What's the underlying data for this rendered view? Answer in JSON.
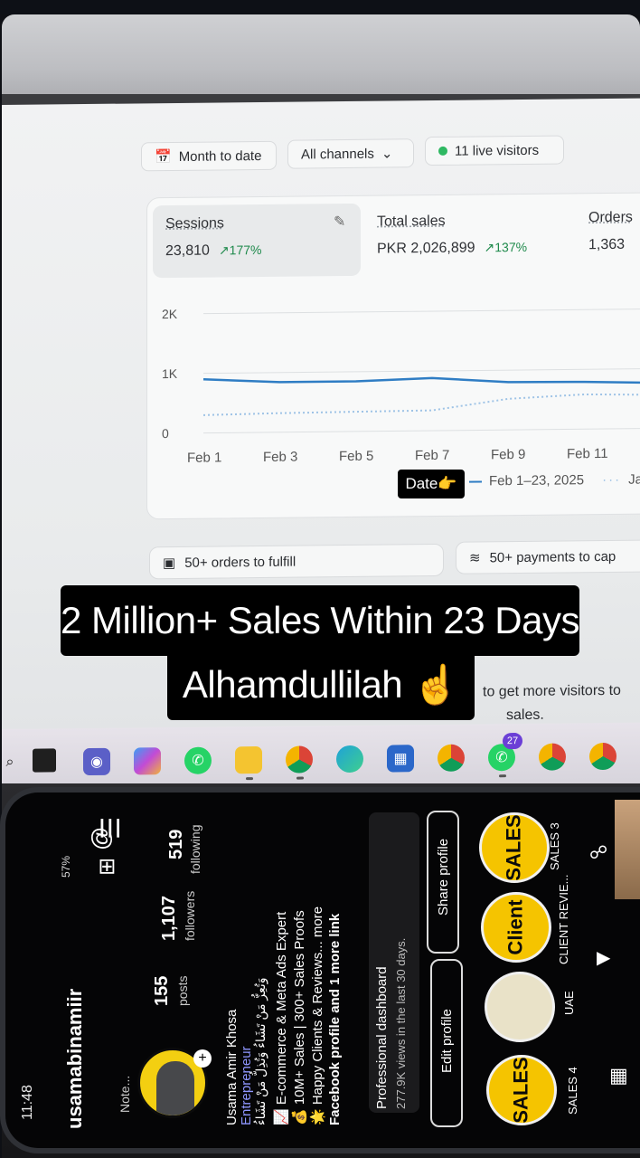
{
  "dashboard": {
    "chips": {
      "month_to_date": "Month to date",
      "all_channels": "All channels",
      "live_visitors": "11 live visitors"
    },
    "metrics": {
      "sessions_label": "Sessions",
      "sessions_value": "23,810",
      "sessions_change": "↗177%",
      "sales_label": "Total sales",
      "sales_value": "PKR 2,026,899",
      "sales_change": "↗137%",
      "orders_label": "Orders",
      "orders_value": "1,363"
    },
    "legend": {
      "current": "Feb 1–23, 2025",
      "previous_prefix": "Ja"
    },
    "tasks": {
      "fulfill": "50+ orders to fulfill",
      "payments": "50+ payments to cap"
    },
    "hint_line1": "to get more visitors to",
    "hint_line2": "sales."
  },
  "chart_data": {
    "type": "line",
    "x": [
      "Feb 1",
      "Feb 3",
      "Feb 5",
      "Feb 7",
      "Feb 9",
      "Feb 11"
    ],
    "yticks": [
      "2K",
      "1K",
      "0"
    ],
    "ylim": [
      0,
      2000
    ],
    "series": [
      {
        "name": "Feb 1–23, 2025",
        "style": "solid",
        "color": "#2f7dc4",
        "values": [
          900,
          840,
          840,
          880,
          800,
          790,
          760
        ]
      },
      {
        "name": "Ja",
        "style": "dotted",
        "color": "#9ec3e6",
        "values": [
          300,
          320,
          330,
          340,
          520,
          580,
          560
        ]
      }
    ]
  },
  "taskbar": {
    "whatsapp_badge": "27"
  },
  "overlay": {
    "caption_line1": "2 Million+ Sales Within 23 Days",
    "caption_line2": "Alhamdullilah ☝️",
    "date_tag": "Date👉"
  },
  "phone": {
    "status_time": "11:48",
    "battery": "57%",
    "username": "usamabinamiir",
    "note": "Note...",
    "posts_count": "155",
    "posts_label": "posts",
    "followers_count": "1,107",
    "followers_label": "followers",
    "following_count": "519",
    "following_label": "following",
    "name": "Usama Amir Khosa",
    "category": "Entrepreneur",
    "bio_arabic": "وَتُعِزُّ مَنْ تَشَاءُ وَتُذِلُّ مَنْ تَشَاءُ",
    "bio_line1": "📈 E-commerce & Meta Ads Expert",
    "bio_line2": "💰 10M+ Sales | 300+ Sales Proofs",
    "bio_line3": "🌟 Happy Clients & Reviews... more",
    "bio_link": "Facebook profile and 1 more link",
    "dashboard_title": "Professional dashboard",
    "dashboard_sub": "277.9K views in the last 30 days.",
    "edit_profile": "Edit profile",
    "share_profile": "Share profile",
    "highlights": [
      {
        "label": "SALES 4",
        "badge": "SALES"
      },
      {
        "label": "UAE",
        "badge": ""
      },
      {
        "label": "CLIENT REVIE...",
        "badge": "Client"
      },
      {
        "label": "SALES 3",
        "badge": "SALES"
      }
    ]
  }
}
